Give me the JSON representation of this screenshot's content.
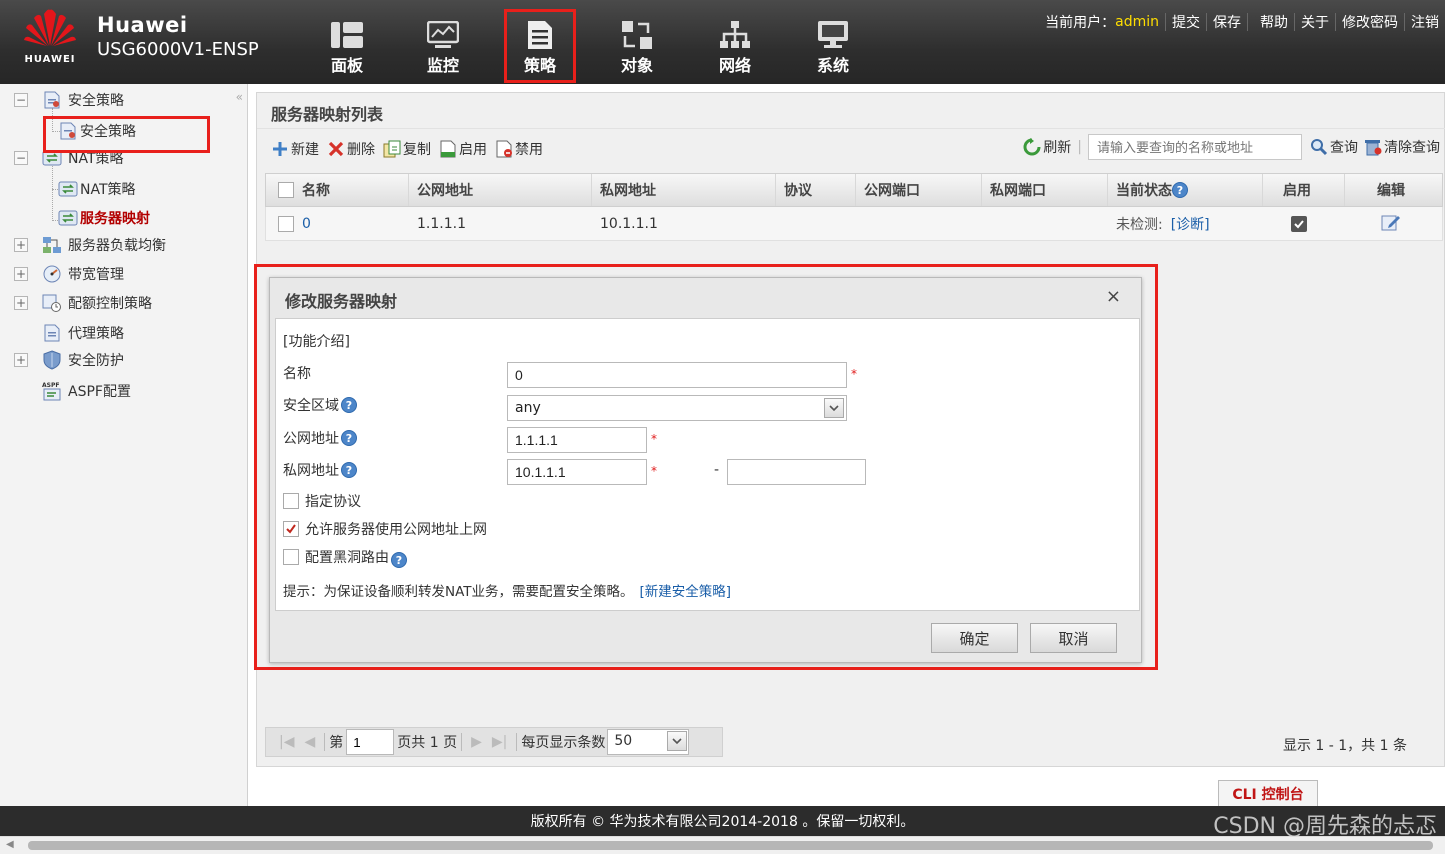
{
  "header": {
    "brand": "HUAWEI",
    "product_name": "Huawei",
    "product_model": "USG6000V1-ENSP",
    "nav": [
      {
        "label": "面板",
        "icon": "dashboard-icon"
      },
      {
        "label": "监控",
        "icon": "monitor-icon"
      },
      {
        "label": "策略",
        "icon": "policy-document-icon",
        "active": true
      },
      {
        "label": "对象",
        "icon": "object-icon"
      },
      {
        "label": "网络",
        "icon": "network-icon"
      },
      {
        "label": "系统",
        "icon": "system-icon"
      }
    ],
    "current_user_label": "当前用户：",
    "current_user": "admin",
    "links": {
      "commit": "提交",
      "save": "保存",
      "help": "帮助",
      "about": "关于",
      "change_password": "修改密码",
      "logout": "注销"
    }
  },
  "sidebar": {
    "collapse": "«",
    "items": [
      {
        "label": "安全策略",
        "toggle": "−"
      },
      {
        "label": "安全策略"
      },
      {
        "label": "NAT策略",
        "toggle": "−"
      },
      {
        "label": "NAT策略"
      },
      {
        "label": "服务器映射",
        "selected": true
      },
      {
        "label": "服务器负载均衡",
        "toggle": "+"
      },
      {
        "label": "带宽管理",
        "toggle": "+"
      },
      {
        "label": "配额控制策略",
        "toggle": "+"
      },
      {
        "label": "代理策略"
      },
      {
        "label": "安全防护",
        "toggle": "+"
      },
      {
        "label": "ASPF配置"
      }
    ]
  },
  "main": {
    "title": "服务器映射列表",
    "toolbar": {
      "new": "新建",
      "delete": "删除",
      "copy": "复制",
      "enable": "启用",
      "disable": "禁用",
      "refresh": "刷新"
    },
    "search": {
      "placeholder": "请输入要查询的名称或地址",
      "query": "查询",
      "clear": "清除查询"
    },
    "columns": [
      "名称",
      "公网地址",
      "私网地址",
      "协议",
      "公网端口",
      "私网端口",
      "当前状态",
      "启用",
      "编辑"
    ],
    "rows": [
      {
        "name": "0",
        "public_address": "1.1.1.1",
        "private_address": "10.1.1.1",
        "protocol": "",
        "public_port": "",
        "private_port": "",
        "status": "未检测:",
        "diagnose": "[诊断]",
        "enabled": true
      }
    ]
  },
  "dialog": {
    "title": "修改服务器映射",
    "close": "×",
    "intro_link": "[功能介绍]",
    "fields": {
      "name_label": "名称",
      "name_value": "0",
      "zone_label": "安全区域",
      "zone_value": "any",
      "public_label": "公网地址",
      "public_value": "1.1.1.1",
      "private_label": "私网地址",
      "private_value": "10.1.1.1",
      "private_range_sep": "-",
      "private_range_end": ""
    },
    "checkboxes": {
      "protocol": {
        "label": "指定协议",
        "checked": false
      },
      "allow_public": {
        "label": "允许服务器使用公网地址上网",
        "checked": true
      },
      "blackhole": {
        "label": "配置黑洞路由",
        "checked": false
      }
    },
    "hint": "提示：为保证设备顺利转发NAT业务，需要配置安全策略。",
    "hint_link": "[新建安全策略]",
    "ok": "确定",
    "cancel": "取消"
  },
  "pager": {
    "page_prefix": "第",
    "page": "1",
    "page_suffix": "页共 1 页",
    "per_page_label": "每页显示条数",
    "per_page": "50",
    "info": "显示 1 - 1，共 1 条"
  },
  "cli_button": "CLI 控制台",
  "footer": "版权所有 © 华为技术有限公司2014-2018 。保留一切权利。",
  "watermark": "CSDN @周先森的忐忑",
  "colors": {
    "accent_red": "#e8201b",
    "user_yellow": "#ffde00",
    "link_blue": "#1a5ea8"
  }
}
